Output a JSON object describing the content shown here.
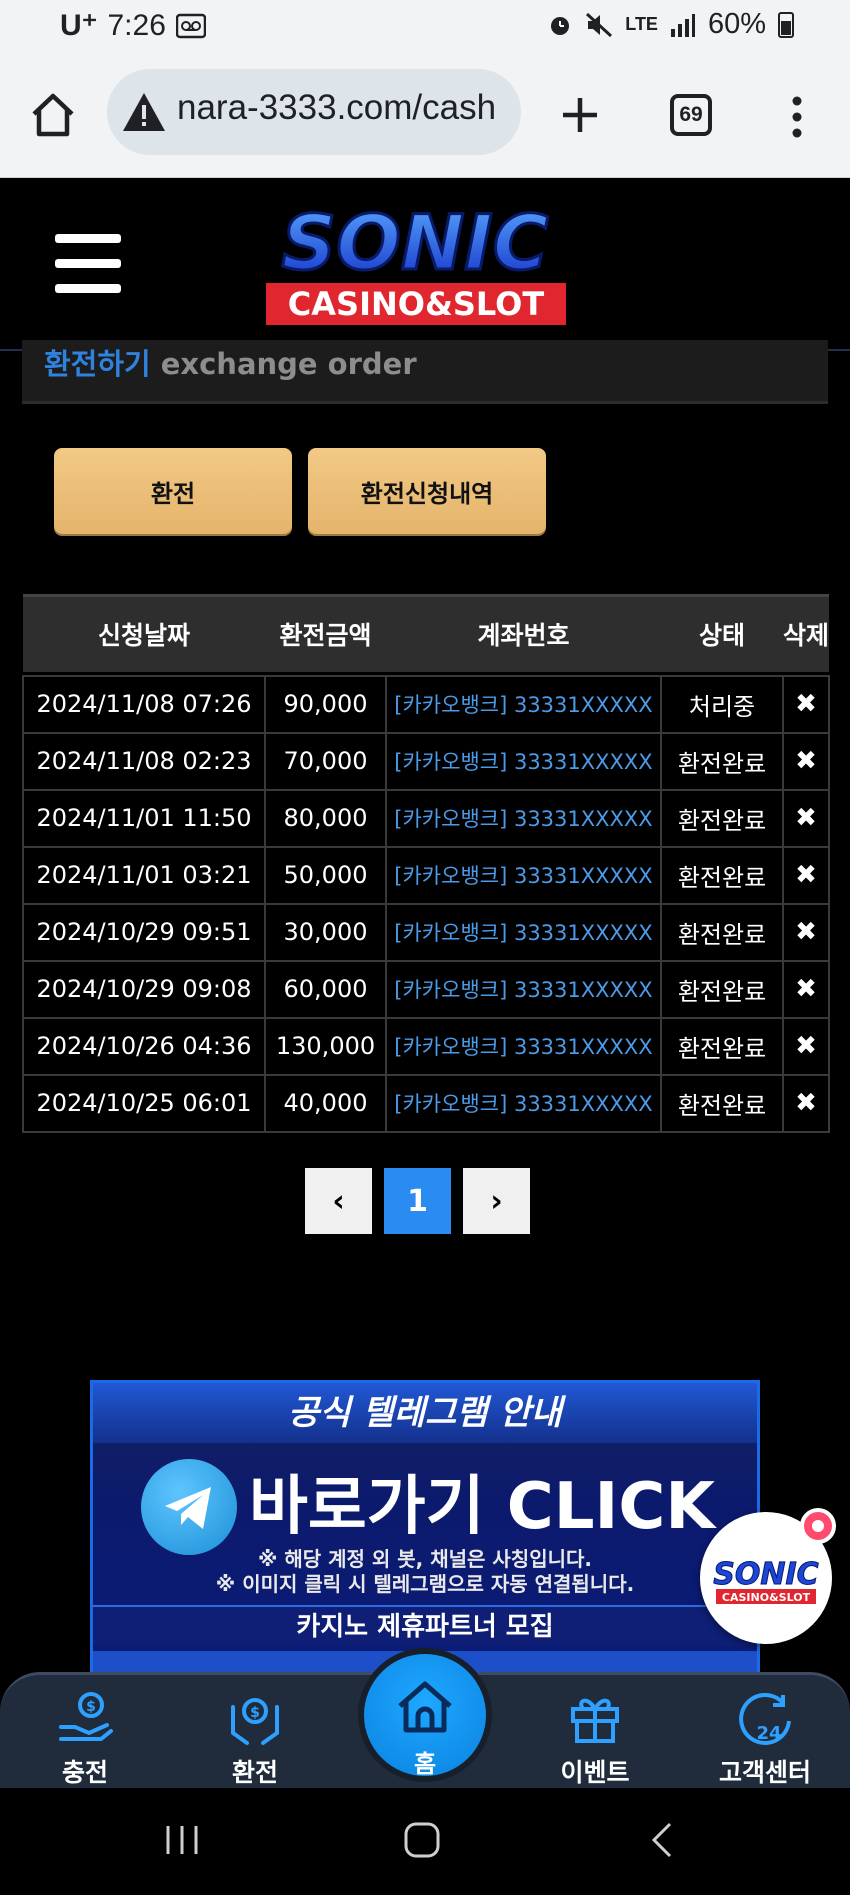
{
  "status_bar": {
    "carrier": "U⁺",
    "time": "7:26",
    "network": "LTE",
    "battery": "60%"
  },
  "browser": {
    "url": "nara-3333.com/cash",
    "tab_count": "69"
  },
  "site": {
    "brand_top": "SONIC",
    "brand_bottom": "CASINO&SLOT"
  },
  "section": {
    "title_ko": "환전하기",
    "title_en": "exchange order"
  },
  "tabs": {
    "exchange": "환전",
    "history": "환전신청내역"
  },
  "table": {
    "headers": [
      "신청날짜",
      "환전금액",
      "계좌번호",
      "상태",
      "삭제"
    ],
    "rows": [
      {
        "date": "2024/11/08 07:26",
        "amount": "90,000",
        "account": "[카카오뱅크] 33331XXXXX",
        "status": "처리중",
        "delete": "✖"
      },
      {
        "date": "2024/11/08 02:23",
        "amount": "70,000",
        "account": "[카카오뱅크] 33331XXXXX",
        "status": "환전완료",
        "delete": "✖"
      },
      {
        "date": "2024/11/01 11:50",
        "amount": "80,000",
        "account": "[카카오뱅크] 33331XXXXX",
        "status": "환전완료",
        "delete": "✖"
      },
      {
        "date": "2024/11/01 03:21",
        "amount": "50,000",
        "account": "[카카오뱅크] 33331XXXXX",
        "status": "환전완료",
        "delete": "✖"
      },
      {
        "date": "2024/10/29 09:51",
        "amount": "30,000",
        "account": "[카카오뱅크] 33331XXXXX",
        "status": "환전완료",
        "delete": "✖"
      },
      {
        "date": "2024/10/29 09:08",
        "amount": "60,000",
        "account": "[카카오뱅크] 33331XXXXX",
        "status": "환전완료",
        "delete": "✖"
      },
      {
        "date": "2024/10/26 04:36",
        "amount": "130,000",
        "account": "[카카오뱅크] 33331XXXXX",
        "status": "환전완료",
        "delete": "✖"
      },
      {
        "date": "2024/10/25 06:01",
        "amount": "40,000",
        "account": "[카카오뱅크] 33331XXXXX",
        "status": "환전완료",
        "delete": "✖"
      }
    ]
  },
  "pagination": {
    "prev": "‹",
    "current": "1",
    "next": "›"
  },
  "banner": {
    "title": "공식 텔레그램 안내",
    "click_text": "바로가기 CLICK",
    "note1": "※ 해당 계정 외 봇, 채널은 사칭입니다.",
    "note2": "※ 이미지 클릭 시 텔레그램으로 자동 연결됩니다.",
    "recruit": "카지노 제휴파트너 모집"
  },
  "float_logo": {
    "brand_top": "SONIC",
    "brand_bottom": "CASINO&SLOT"
  },
  "bottom_nav": {
    "charge": "충전",
    "exchange": "환전",
    "home": "홈",
    "event": "이벤트",
    "support": "고객센터"
  },
  "colors": {
    "accent_blue": "#2a8bf0",
    "tab_gold": "#e8b870",
    "account_blue": "#4b9be8",
    "brand_red": "#e0262f"
  }
}
